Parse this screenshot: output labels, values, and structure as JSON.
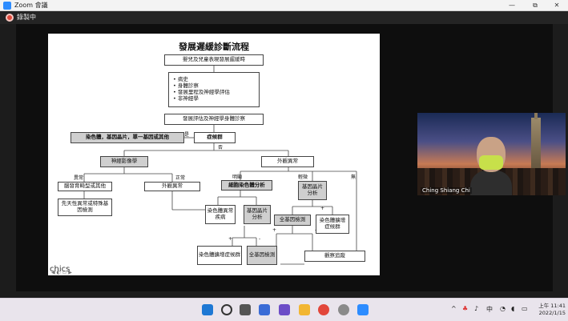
{
  "window": {
    "app_name": "Zoom 會議",
    "minimize": "—",
    "maximize": "⧉",
    "close": "✕"
  },
  "recording": {
    "label": "錄製中"
  },
  "slide": {
    "title": "發展遲緩診斷流程",
    "footer_logo": "chics",
    "footer_nav": "◀ ◐ ▭ ▶",
    "boxes": {
      "trigger": "嬰兒及兒童表現發展遲緩時",
      "history_1": "• 病史",
      "history_2": "• 身體診察",
      "history_3": "• 發展里程及神經學評估",
      "history_4": "• 非神經學",
      "assessment": "發展評估及神經學身體診察",
      "chromosome": "染色體，基因晶片，單一基因或其他",
      "syndrome": "症候群",
      "neuroimaging": "神經影像學",
      "external_abnormal": "外觀異常",
      "brain_malformation": "腦發育畸型或其他",
      "congenital": "先天性異常或特殊基因檢測",
      "external_normal": "外觀異常",
      "cell_chromosome": "細胞染色體分析",
      "gene_chip_1": "基因晶片分析",
      "chromosome_disease": "染色體異常疾病",
      "gene_chip_2": "基因晶片分析",
      "whole_genome_1": "全基因檢測",
      "chromosome_amplification_1": "染色體擴增症候群",
      "chromosome_amplification_2": "染色體擴增症候群",
      "whole_genome_2": "全基因檢測",
      "observe": "觀察追蹤"
    },
    "labels": {
      "yes": "是",
      "no": "否",
      "abnormal": "異常",
      "normal": "正常",
      "obvious": "明顯",
      "mild": "輕微",
      "none": "無",
      "plus_1": "+",
      "minus_1": "-",
      "plus_2": "+",
      "minus_2": "-",
      "plus_3": "+",
      "minus_3": "-"
    }
  },
  "participant": {
    "name": "Ching Shiang Chi"
  },
  "taskbar": {
    "ime": "中",
    "time": "上午 11:41",
    "date": "2022/1/15"
  }
}
